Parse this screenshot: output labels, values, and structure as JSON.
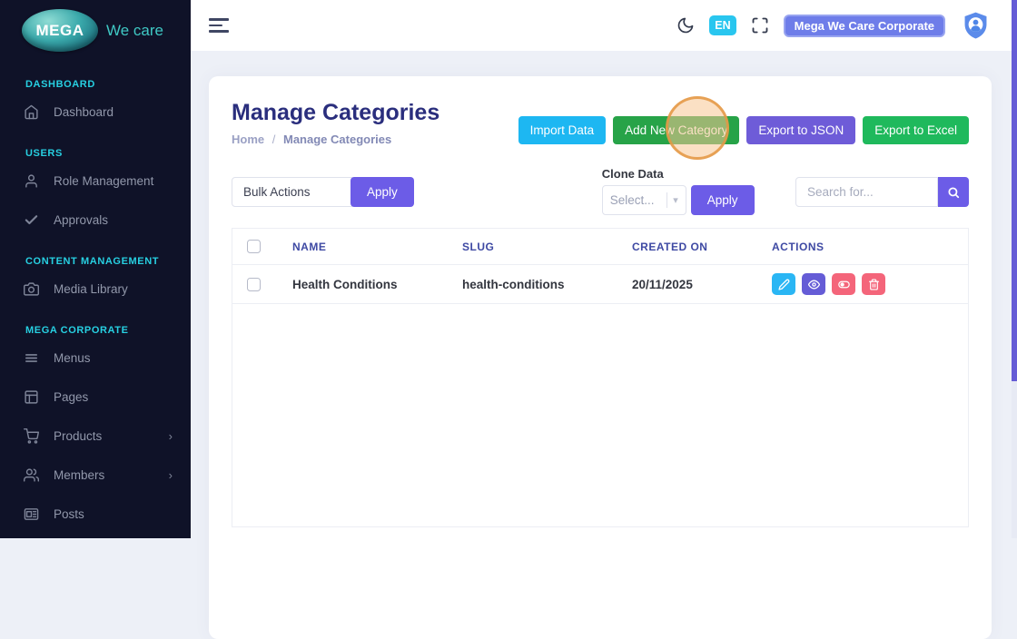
{
  "brand": {
    "logo_text": "MEGA",
    "logo_tagline": "We care"
  },
  "sidebar": {
    "sections": [
      {
        "label": "DASHBOARD",
        "items": [
          {
            "icon": "home-icon",
            "label": "Dashboard"
          }
        ]
      },
      {
        "label": "USERS",
        "items": [
          {
            "icon": "user-icon",
            "label": "Role Management"
          },
          {
            "icon": "check-icon",
            "label": "Approvals"
          }
        ]
      },
      {
        "label": "CONTENT MANAGEMENT",
        "items": [
          {
            "icon": "camera-icon",
            "label": "Media Library"
          }
        ]
      },
      {
        "label": "MEGA CORPORATE",
        "items": [
          {
            "icon": "menu-lines-icon",
            "label": "Menus"
          },
          {
            "icon": "layout-icon",
            "label": "Pages"
          },
          {
            "icon": "cart-icon",
            "label": "Products",
            "chevron": "›"
          },
          {
            "icon": "users-icon",
            "label": "Members",
            "chevron": "›"
          },
          {
            "icon": "newspaper-icon",
            "label": "Posts"
          }
        ]
      }
    ]
  },
  "topbar": {
    "language_badge": "EN",
    "workspace_button": "Mega We Care Corporate"
  },
  "page": {
    "title": "Manage Categories",
    "breadcrumb": {
      "home": "Home",
      "separator": "/",
      "current": "Manage Categories"
    },
    "action_buttons": {
      "import": "Import Data",
      "add_new": "Add New Category",
      "export_json": "Export to JSON",
      "export_excel": "Export to Excel"
    }
  },
  "filters": {
    "bulk_actions_value": "Bulk Actions",
    "bulk_apply_label": "Apply",
    "clone_data_label": "Clone Data",
    "clone_select_placeholder": "Select...",
    "clone_apply_label": "Apply",
    "search_placeholder": "Search for..."
  },
  "table": {
    "headers": {
      "name": "NAME",
      "slug": "SLUG",
      "created_on": "CREATED ON",
      "actions": "ACTIONS"
    },
    "rows": [
      {
        "name": "Health Conditions",
        "slug": "health-conditions",
        "created_on": "20/11/2025"
      }
    ]
  },
  "colors": {
    "sidebar_bg": "#0f1228",
    "section_label": "#27d0e2",
    "accent_purple": "#6c5ce7",
    "btn_cyan": "#1db7f2",
    "btn_green": "#27a348",
    "btn_export_json": "#6e5cd8",
    "btn_export_excel": "#1fb95c",
    "action_edit": "#2ab6f4",
    "action_view": "#655cd6",
    "action_toggle": "#f4657a",
    "action_delete": "#f4657a",
    "lang_badge": "#29c6ef",
    "workspace_btn": "#6e7de9",
    "click_highlight_border": "#e49642",
    "title": "#2a2e7d",
    "header_text": "#3e49a3"
  }
}
